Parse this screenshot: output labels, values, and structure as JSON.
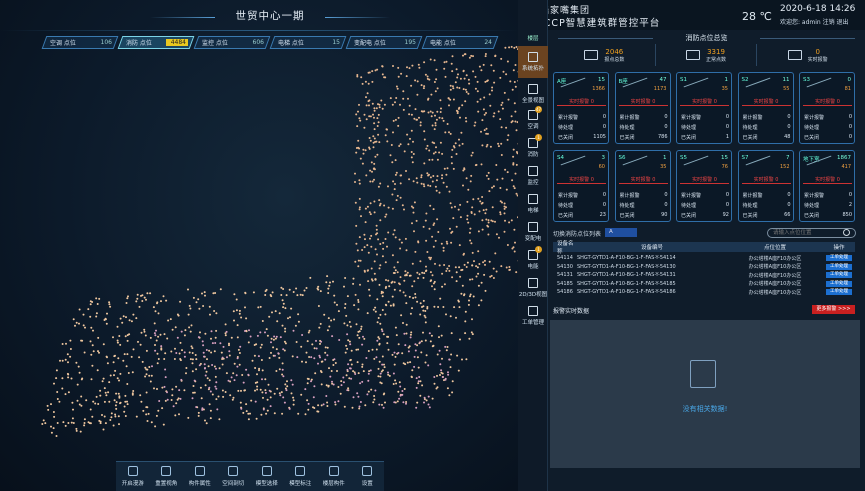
{
  "left": {
    "title": "世贸中心一期",
    "pills": [
      {
        "label": "空调 点位",
        "count": "106"
      },
      {
        "label": "消防 点位",
        "count": "4484",
        "active": true
      },
      {
        "label": "监控 点位",
        "count": "606"
      },
      {
        "label": "电梯 点位",
        "count": "15"
      },
      {
        "label": "变配电 点位",
        "count": "195"
      },
      {
        "label": "电能 点位",
        "count": "24"
      }
    ],
    "toolbar": [
      "开启漫游",
      "重置视角",
      "构件属性",
      "空间剖切",
      "模型选择",
      "模型标注",
      "楼层构件",
      "设置"
    ]
  },
  "nav": {
    "head": "楼层",
    "items": [
      {
        "label": "系统拓扑",
        "active": true
      },
      {
        "label": "全景视图"
      },
      {
        "label": "空调",
        "badge": "47"
      },
      {
        "label": "消防",
        "badge": "1"
      },
      {
        "label": "监控"
      },
      {
        "label": "电梯"
      },
      {
        "label": "变配电"
      },
      {
        "label": "电能",
        "badge": "1"
      },
      {
        "label": "2D/3D视图"
      },
      {
        "label": "工单管理"
      }
    ]
  },
  "header": {
    "brand_line1": "陆家嘴集团",
    "brand_line2": "ICCP智慧建筑群管控平台",
    "temperature": "28 ℃",
    "datetime": "2020-6-18 14:26",
    "user": "欢迎您: admin  注销  退出"
  },
  "panel": {
    "title": "消防点位总览",
    "summary": [
      {
        "value": "2046",
        "label": "报点总数"
      },
      {
        "value": "3319",
        "label": "正常点数"
      },
      {
        "value": "0",
        "label": "实时报警"
      }
    ],
    "cards": [
      {
        "name": "A座",
        "c": "15",
        "t": "1366",
        "alarm": "实时报警 0",
        "acc": "0",
        "pend": "0",
        "closed": "1105"
      },
      {
        "name": "B座",
        "c": "47",
        "t": "1173",
        "alarm": "实时报警 0",
        "acc": "0",
        "pend": "0",
        "closed": "786"
      },
      {
        "name": "S1",
        "c": "1",
        "t": "35",
        "alarm": "实时报警 0",
        "acc": "0",
        "pend": "0",
        "closed": "1"
      },
      {
        "name": "S2",
        "c": "11",
        "t": "55",
        "alarm": "实时报警 0",
        "acc": "0",
        "pend": "0",
        "closed": "48"
      },
      {
        "name": "S3",
        "c": "0",
        "t": "81",
        "alarm": "实时报警 0",
        "acc": "0",
        "pend": "0",
        "closed": "0"
      },
      {
        "name": "S4",
        "c": "3",
        "t": "60",
        "alarm": "实时报警 0",
        "acc": "0",
        "pend": "0",
        "closed": "23"
      },
      {
        "name": "S6",
        "c": "1",
        "t": "35",
        "alarm": "实时报警 0",
        "acc": "0",
        "pend": "0",
        "closed": "90"
      },
      {
        "name": "S5",
        "c": "15",
        "t": "76",
        "alarm": "实时报警 0",
        "acc": "0",
        "pend": "0",
        "closed": "92"
      },
      {
        "name": "S7",
        "c": "7",
        "t": "152",
        "alarm": "实时报警 0",
        "acc": "0",
        "pend": "0",
        "closed": "66"
      },
      {
        "name": "地下室",
        "c": "1867",
        "t": "417",
        "alarm": "实时报警 0",
        "acc": "0",
        "pend": "2",
        "closed": "850"
      }
    ],
    "card_labels": {
      "acc": "累计报警",
      "pend": "待处理",
      "closed": "已关闭"
    },
    "filter_label": "切换消防点位列表",
    "select_value": "A",
    "search_placeholder": "请输入点位位置",
    "table": {
      "headers": [
        "设备名称",
        "设备编号",
        "点位位置",
        "操作"
      ],
      "rows": [
        [
          "54114",
          "SHGT-GYTD1-A-F10-BG-1-F-FAS-Y-54114",
          "办公塔楼A座F10办公区",
          "工单处理"
        ],
        [
          "54130",
          "SHGT-GYTD1-A-F10-BG-1-F-FAS-Y-54130",
          "办公塔楼A座F10办公区",
          "工单处理"
        ],
        [
          "54131",
          "SHGT-GYTD1-A-F10-BG-1-F-FAS-Y-54131",
          "办公塔楼A座F10办公区",
          "工单处理"
        ],
        [
          "54185",
          "SHGT-GYTD1-A-F10-BG-1-F-FAS-Y-54185",
          "办公塔楼A座F10办公区",
          "工单处理"
        ],
        [
          "54186",
          "SHGT-GYTD1-A-F10-BG-1-F-FAS-Y-54186",
          "办公塔楼A座F10办公区",
          "工单处理"
        ]
      ]
    },
    "alarm_header": "报警实时数据",
    "more_label": "更多报警 >>>",
    "empty_text": "没有相关数据!"
  }
}
